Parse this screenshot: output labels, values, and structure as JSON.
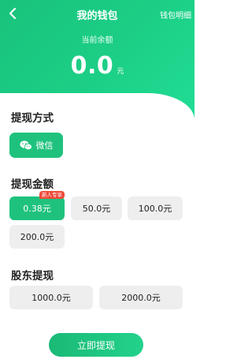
{
  "header": {
    "title": "我的钱包",
    "detail_link": "钱包明细",
    "balance_label": "当前余额",
    "balance_amount": "0.0",
    "balance_unit": "元"
  },
  "withdraw_method": {
    "title": "提现方式",
    "option_label": "微信"
  },
  "withdraw_amount": {
    "title": "提现金额",
    "badge": "新人专享",
    "options": [
      "0.38元",
      "50.0元",
      "100.0元",
      "200.0元"
    ]
  },
  "shareholder": {
    "title": "股东提现",
    "options": [
      "1000.0元",
      "2000.0元"
    ]
  },
  "actions": {
    "withdraw_now": "立即提现"
  },
  "colors": {
    "accent": "#1fc27d",
    "badge": "#ef4a3b"
  }
}
